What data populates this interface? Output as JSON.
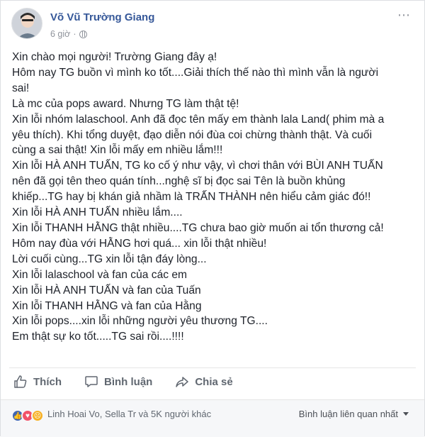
{
  "post": {
    "author": "Võ Vũ Trường Giang",
    "time": "6 giờ",
    "time_separator": "·",
    "privacy_icon": "globe-icon",
    "lines": [
      "Xin chào mọi người! Trường Giang đây ạ!",
      "Hôm nay TG buồn vì mình ko tốt....Giải thích thế nào thì mình vẫn là người",
      "sai!",
      "Là mc của pops award. Nhưng TG làm thật tệ!",
      "Xin lỗi nhóm lalaschool. Anh đã đọc tên mấy em thành lala Land( phim mà a",
      "yêu thích). Khi tổng duyệt, đạo diễn nói đùa coi chừng thành thật. Và cuối",
      "cùng a sai thật! Xin lỗi mấy em nhiều lắm!!!",
      "Xin lỗi HÀ ANH TUẤN, TG ko cố ý như vậy, vì chơi thân với BÙI ANH TUẤN",
      "nên đã gọi tên theo quán tính...nghệ sĩ bị đọc sai Tên là buồn khủng",
      "khiếp...TG hay bị khán giả nhầm là TRẤN THÀNH nên hiểu cảm giác đó!!",
      "Xin lỗi HÀ ANH TUẤN nhiều lắm....",
      "Xin lỗi THANH HẰNG thật nhiều....TG chưa bao giờ muốn ai tổn thương cả!",
      "Hôm nay đùa với HẰNG hơi quá... xin lỗi thật nhiều!",
      "Lời cuối cùng...TG xin lỗi tận đáy lòng...",
      "Xin lỗi lalaschool và fan của các em",
      "Xin lỗi HÀ ANH TUẤN và fan của Tuấn",
      "Xin lỗi THANH HẰNG và fan của Hằng",
      "Xin lỗi pops....xin lỗi những người yêu thương TG....",
      "Em thật sự ko tốt.....TG sai rồi....!!!!"
    ]
  },
  "actions": {
    "like": "Thích",
    "comment": "Bình luận",
    "share": "Chia sẻ"
  },
  "footer": {
    "reactors": "Linh Hoai Vo, Sella Tr và 5K người khác",
    "sort": "Bình luận liên quan nhất"
  },
  "colors": {
    "link": "#365899",
    "like_blue": "#4267b2",
    "text": "#1d2129",
    "muted": "#90949c"
  }
}
